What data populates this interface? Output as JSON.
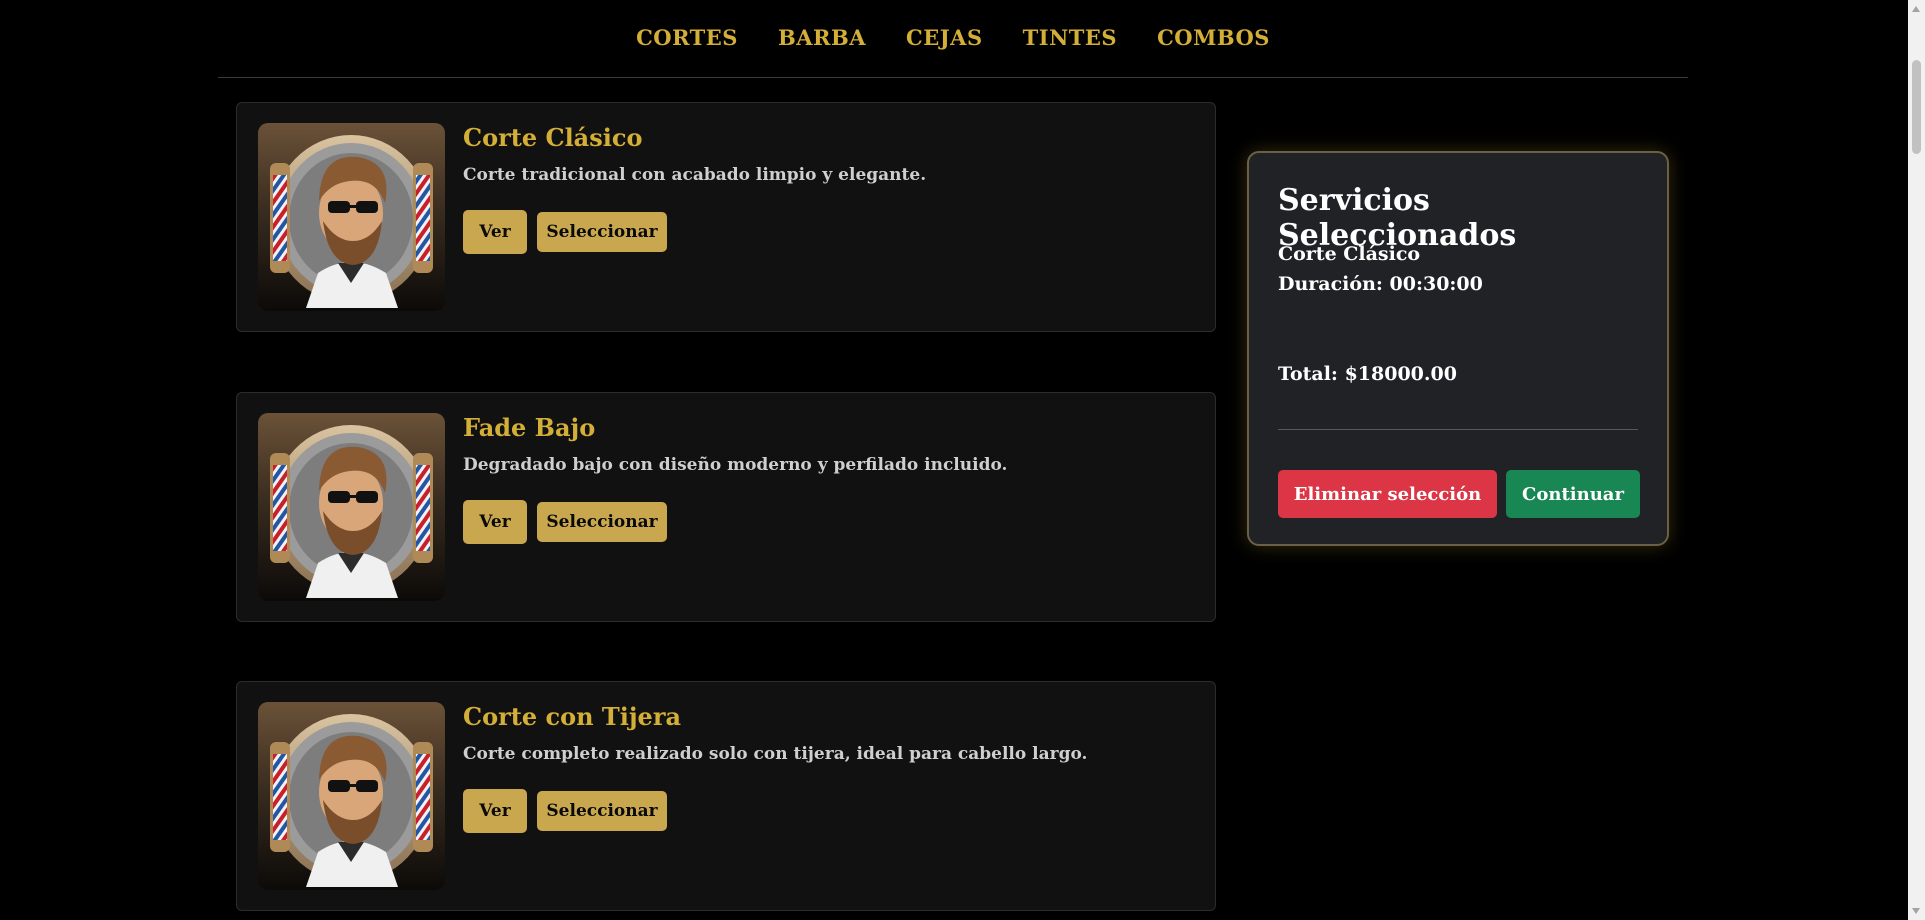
{
  "nav": {
    "items": [
      "CORTES",
      "BARBA",
      "CEJAS",
      "TINTES",
      "COMBOS"
    ]
  },
  "services": [
    {
      "title": "Corte Clásico",
      "description": "Corte tradicional con acabado limpio y elegante.",
      "view_label": "Ver",
      "select_label": "Seleccionar",
      "image": "barber-portrait-icon"
    },
    {
      "title": "Fade Bajo",
      "description": "Degradado bajo con diseño moderno y perfilado incluido.",
      "view_label": "Ver",
      "select_label": "Seleccionar",
      "image": "barber-portrait-icon"
    },
    {
      "title": "Corte con Tijera",
      "description": "Corte completo realizado solo con tijera, ideal para cabello largo.",
      "view_label": "Ver",
      "select_label": "Seleccionar",
      "image": "barber-portrait-icon"
    }
  ],
  "summary": {
    "heading": "Servicios Seleccionados",
    "item_name": "Corte Clásico",
    "item_duration": "Duración: 00:30:00",
    "total": "Total: $18000.00",
    "clear_label": "Eliminar selección",
    "continue_label": "Continuar"
  },
  "colors": {
    "gold": "#d4af37",
    "button_gold": "#c9a74e",
    "danger": "#dc3545",
    "success": "#198754",
    "panel": "#202226",
    "card": "#111111"
  }
}
